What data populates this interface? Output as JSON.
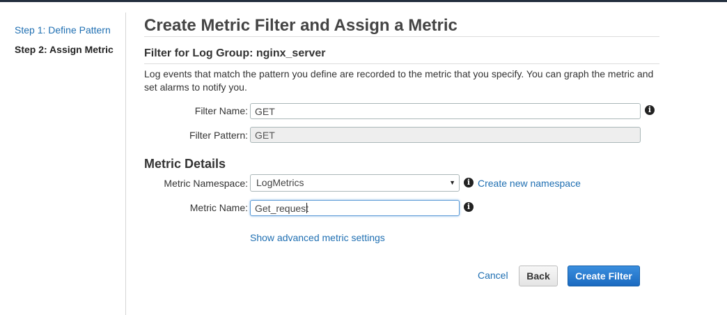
{
  "wizard": {
    "steps": [
      {
        "label": "Step 1: Define Pattern"
      },
      {
        "label": "Step 2: Assign Metric"
      }
    ]
  },
  "page": {
    "title": "Create Metric Filter and Assign a Metric",
    "filter_heading": "Filter for Log Group: nginx_server",
    "description": "Log events that match the pattern you define are recorded to the metric that you specify. You can graph the metric and set alarms to notify you."
  },
  "filter": {
    "name_label": "Filter Name:",
    "name_value": "GET",
    "pattern_label": "Filter Pattern:",
    "pattern_value": "GET"
  },
  "metric": {
    "section_title": "Metric Details",
    "namespace_label": "Metric Namespace:",
    "namespace_value": "LogMetrics",
    "create_namespace_link": "Create new namespace",
    "name_label": "Metric Name:",
    "name_value": "Get_request",
    "advanced_link": "Show advanced metric settings"
  },
  "actions": {
    "cancel": "Cancel",
    "back": "Back",
    "create": "Create Filter"
  },
  "icons": {
    "info": "i",
    "dropdown": "▼"
  },
  "colors": {
    "link": "#1f6fb2",
    "primary_button": "#1b6ac0"
  }
}
